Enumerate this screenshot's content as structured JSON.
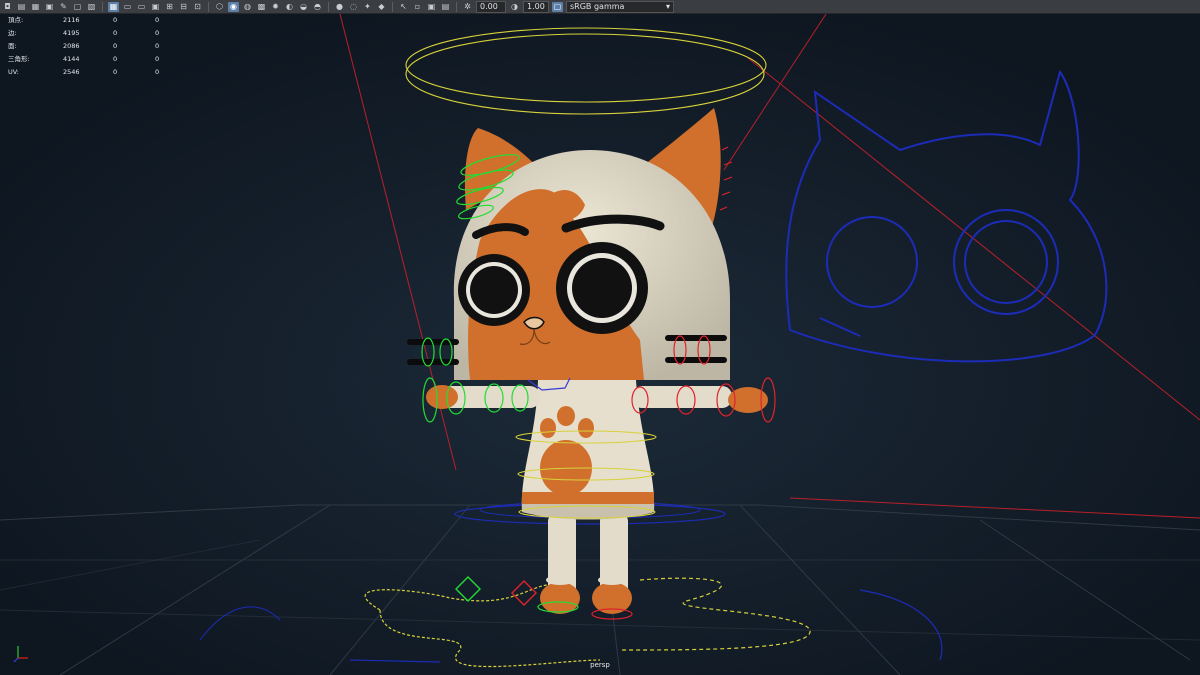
{
  "toolbar": {
    "icons_left": [
      "camera-icon",
      "bookmark-icon",
      "film-icon",
      "image-plane-icon",
      "grease-pencil-icon",
      "frame-icon",
      "grid-icon"
    ],
    "icons_mid": [
      "wireframe-icon",
      "smooth-shade-icon",
      "textured-icon",
      "lights-icon",
      "shadows-icon",
      "ambient-occlusion-icon",
      "motion-blur-icon",
      "anti-alias-icon"
    ],
    "icons_right": [
      "isolate-icon",
      "xray-icon",
      "xray-joints-icon",
      "xray-active-icon",
      "gate-icon",
      "safe-action-icon",
      "film-gate-icon"
    ],
    "exposure_value": "0.00",
    "gamma_value": "1.00",
    "colorspace_label": "sRGB gamma",
    "colors": {
      "bar": "#3a3d42",
      "active": "#5b7fa6"
    }
  },
  "hud": {
    "rows": [
      {
        "label": "頂点:",
        "values": [
          "2116",
          "0",
          "0"
        ]
      },
      {
        "label": "边:",
        "values": [
          "4195",
          "0",
          "0"
        ]
      },
      {
        "label": "面:",
        "values": [
          "2086",
          "0",
          "0"
        ]
      },
      {
        "label": "三角形:",
        "values": [
          "4144",
          "0",
          "0"
        ]
      },
      {
        "label": "UV:",
        "values": [
          "2546",
          "0",
          "0"
        ]
      }
    ]
  },
  "viewport": {
    "camera_label": "persp",
    "colors": {
      "background": "#111a24",
      "grid": "#2e3945",
      "left_controls": "#22dd33",
      "right_controls": "#e0222b",
      "center_controls": "#d8d23a",
      "ortho_guides": "#1a2ab0",
      "body_orange": "#d0702c",
      "body_cream": "#e6dfcd"
    }
  }
}
